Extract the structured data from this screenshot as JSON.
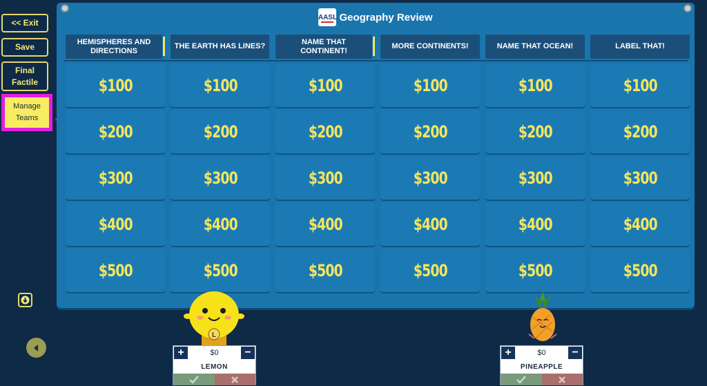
{
  "sidebar": {
    "exit_label": "<< Exit",
    "save_label": "Save",
    "final_label": "Final Factile",
    "manage_label": "Manage Teams"
  },
  "board": {
    "title": "Geography Review",
    "logo_text": "AASL",
    "categories": [
      "HEMISPHERES AND DIRECTIONS",
      "THE EARTH HAS LINES?",
      "NAME THAT CONTINENT!",
      "MORE CONTINENTS!",
      "NAME THAT OCEAN!",
      "LABEL THAT!"
    ],
    "values": [
      "$100",
      "$200",
      "$300",
      "$400",
      "$500"
    ]
  },
  "teams": [
    {
      "name": "LEMON",
      "score": "$0",
      "mascot_label": "L",
      "mascot": "lemon"
    },
    {
      "name": "PINEAPPLE",
      "score": "$0",
      "mascot": "pineapple"
    }
  ],
  "colors": {
    "background": "#0e2a46",
    "board": "#1a75ad",
    "value_text": "#f5e55e",
    "highlight": "#e21ee2"
  }
}
